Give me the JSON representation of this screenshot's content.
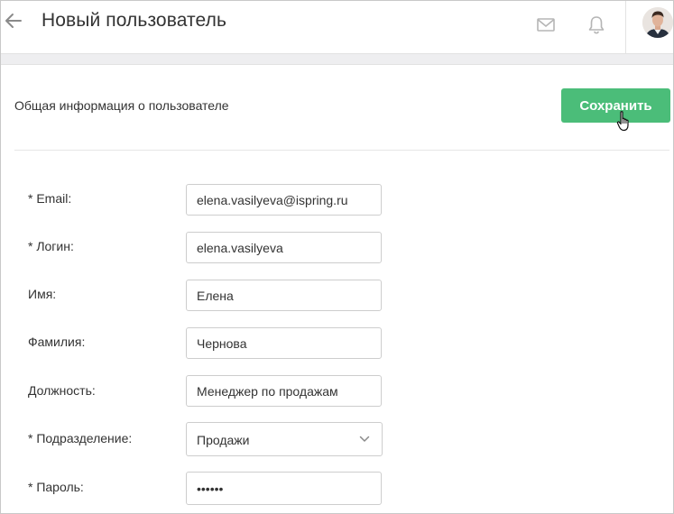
{
  "header": {
    "title": "Новый пользователь",
    "icons": [
      "arrow-left-icon",
      "mail-icon",
      "bell-icon",
      "avatar"
    ]
  },
  "section": {
    "title": "Общая информация о пользователе",
    "save_label": "Сохранить"
  },
  "form": {
    "email_label": "* Email:",
    "email_value": "elena.vasilyeva@ispring.ru",
    "login_label": "* Логин:",
    "login_value": "elena.vasilyeva",
    "firstname_label": "Имя:",
    "firstname_value": "Елена",
    "lastname_label": "Фамилия:",
    "lastname_value": "Чернова",
    "position_label": "Должность:",
    "position_value": "Менеджер по продажам",
    "department_label": "* Подразделение:",
    "department_value": "Продажи",
    "password_label": "* Пароль:",
    "password_value": "••••••"
  },
  "colors": {
    "accent_green": "#4bbd79",
    "icon_grey": "#b5b5b5",
    "border": "#cdcdcd"
  }
}
